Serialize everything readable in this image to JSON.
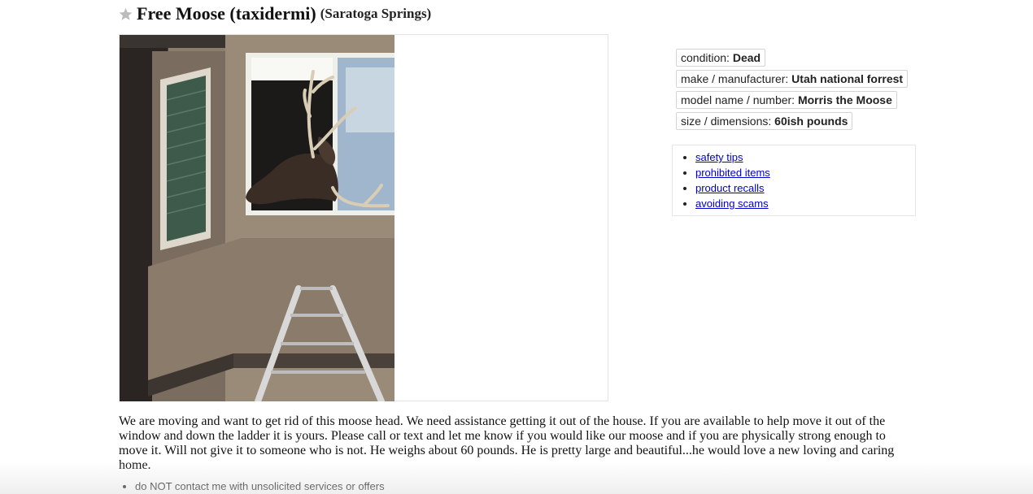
{
  "posting": {
    "title": "Free Moose (taxidermi)",
    "location": "(Saratoga Springs)",
    "favorite_icon": "star-icon"
  },
  "attributes": [
    {
      "label": "condition: ",
      "value": "Dead"
    },
    {
      "label": "make / manufacturer: ",
      "value": "Utah national forrest"
    },
    {
      "label": "model name / number: ",
      "value": "Morris the Moose"
    },
    {
      "label": "size / dimensions: ",
      "value": "60ish pounds"
    }
  ],
  "safety_links": [
    "safety tips",
    "prohibited items",
    "product recalls",
    "avoiding scams"
  ],
  "description": "We are moving and want to get rid of this moose head. We need assistance getting it out of the house. If you are available to help move it out of the window and down the ladder it is yours. Please call or text and let me know if you would like our moose and if you are physically strong enough to move it. Will not give it to someone who is not. He weighs about 60 pounds. He is pretty large and beautiful...he would love a new loving and caring home.",
  "notices": [
    "do NOT contact me with unsolicited services or offers"
  ],
  "colors": {
    "link": "#0000cc",
    "border": "#d4d4d4"
  }
}
